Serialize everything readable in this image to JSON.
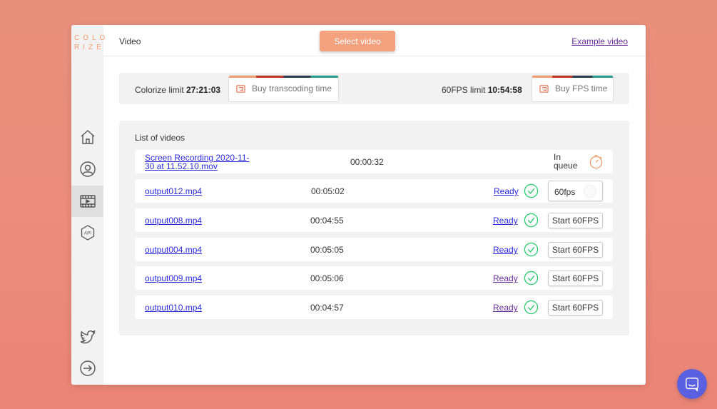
{
  "app": {
    "logo_line1": "COLO",
    "logo_line2": "RIZE",
    "page_title": "Video",
    "select_video_label": "Select video",
    "example_video_label": "Example video"
  },
  "colors": {
    "accent": "#f3a17e",
    "link": "#2a2adb",
    "visited_link": "#6a2e9a",
    "ready_green": "#2ecc71",
    "chat": "#5b60e0"
  },
  "sidebar": {
    "items": [
      {
        "name": "home",
        "icon": "home-icon",
        "active": false
      },
      {
        "name": "profile",
        "icon": "user-icon",
        "active": false
      },
      {
        "name": "videos",
        "icon": "video-icon",
        "active": true
      },
      {
        "name": "api",
        "icon": "api-icon",
        "active": false
      },
      {
        "name": "twitter",
        "icon": "twitter-icon",
        "active": false
      },
      {
        "name": "logout",
        "icon": "logout-icon",
        "active": false
      }
    ]
  },
  "limits": {
    "colorize_label": "Colorize limit",
    "colorize_value": "27:21:03",
    "buy_transcoding_label": "Buy transcoding time",
    "fps_label": "60FPS limit",
    "fps_value": "10:54:58",
    "buy_fps_label": "Buy FPS time"
  },
  "videos": {
    "title": "List of videos",
    "rows": [
      {
        "name": "Screen Recording 2020-11-30 at 11.52.10.mov",
        "duration": "00:00:32",
        "status": "In queue",
        "action": "timer"
      },
      {
        "name": "output012.mp4",
        "duration": "00:05:02",
        "status": "Ready",
        "action_label": "60fps",
        "action": "toggle"
      },
      {
        "name": "output008.mp4",
        "duration": "00:04:55",
        "status": "Ready",
        "action_label": "Start 60FPS",
        "action": "button"
      },
      {
        "name": "output004.mp4",
        "duration": "00:05:05",
        "status": "Ready",
        "action_label": "Start 60FPS",
        "action": "button"
      },
      {
        "name": "output009.mp4",
        "duration": "00:05:06",
        "status": "Ready",
        "action_label": "Start 60FPS",
        "action": "button"
      },
      {
        "name": "output010.mp4",
        "duration": "00:04:57",
        "status": "Ready",
        "action_label": "Start 60FPS",
        "action": "button"
      }
    ]
  },
  "chat": {
    "icon": "chat-icon"
  }
}
